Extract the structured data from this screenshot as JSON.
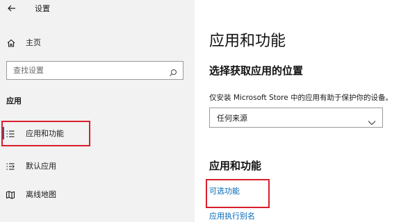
{
  "window": {
    "title": "设置"
  },
  "sidebar": {
    "home_label": "主页",
    "search": {
      "placeholder": "查找设置"
    },
    "section_heading": "应用",
    "items": [
      {
        "label": "应用和功能",
        "icon": "apps-features-icon",
        "selected": true
      },
      {
        "label": "默认应用",
        "icon": "default-apps-icon",
        "selected": false
      },
      {
        "label": "离线地图",
        "icon": "offline-maps-icon",
        "selected": false
      }
    ]
  },
  "main": {
    "page_title": "应用和功能",
    "choose_heading": "选择获取应用的位置",
    "description": "仅安装 Microsoft Store 中的应用有助于保护你的设备。",
    "source_dropdown": {
      "selected": "任何来源"
    },
    "section_heading": "应用和功能",
    "links": {
      "optional_features": "可选功能",
      "app_alias": "应用执行别名"
    }
  },
  "colors": {
    "accent": "#0067b8",
    "highlight_outline": "#d81e2b",
    "sidebar_bg": "#f2f2f2"
  }
}
